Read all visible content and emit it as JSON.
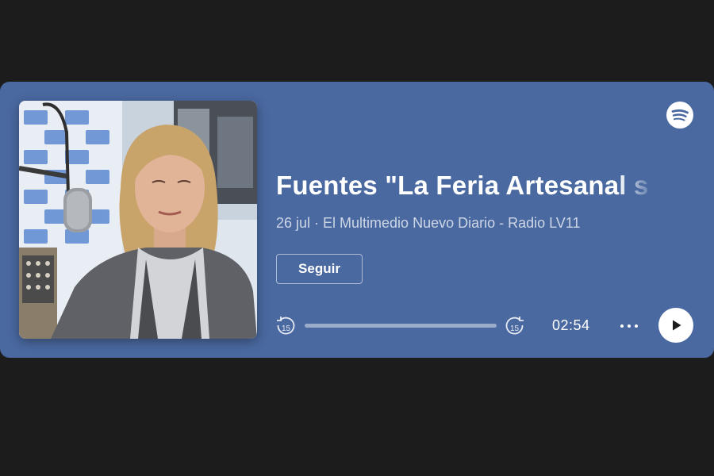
{
  "episode": {
    "title": "Fuentes \"La Feria Artesanal s",
    "subtitle": "26 jul · El Multimedio Nuevo Diario - Radio LV11",
    "cover_icon": "podcast-cover-image"
  },
  "actions": {
    "follow_label": "Seguir"
  },
  "player": {
    "duration": "02:54",
    "progress_fraction": 0,
    "skip_back_seconds": "15",
    "skip_forward_seconds": "15",
    "play_icon": "play-icon",
    "more_icon": "more-options-icon"
  },
  "brand": {
    "logo": "spotify-icon",
    "card_color": "#4a69a0",
    "background_color": "#1c1c1d"
  }
}
